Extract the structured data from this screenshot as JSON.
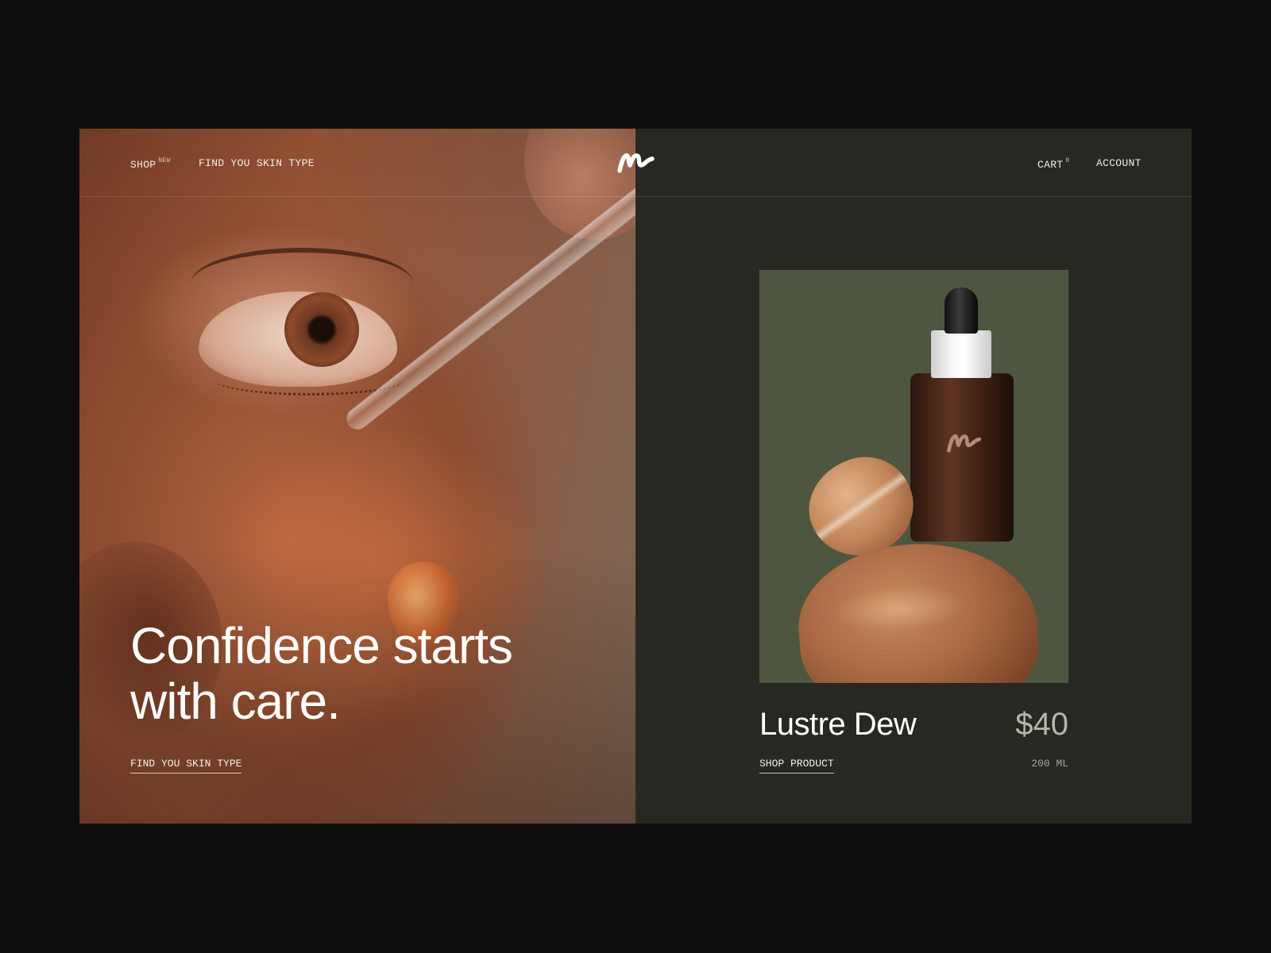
{
  "nav": {
    "shop_label": "SHOP",
    "shop_badge": "NEW",
    "find_skin_label": "FIND YOU SKIN TYPE",
    "cart_label": "CART",
    "cart_count": "0",
    "account_label": "ACCOUNT"
  },
  "hero": {
    "headline": "Confidence starts with care.",
    "cta_label": "FIND YOU SKIN TYPE"
  },
  "product": {
    "name": "Lustre Dew",
    "price": "$40",
    "cta_label": "SHOP PRODUCT",
    "volume": "200 ML"
  },
  "icons": {
    "logo": "brand-logo-icon"
  },
  "colors": {
    "page_bg": "#0d0d0d",
    "panel_bg": "#272822",
    "product_bg": "#4f563f",
    "text": "#ffffff",
    "price": "#b7b5ad"
  }
}
